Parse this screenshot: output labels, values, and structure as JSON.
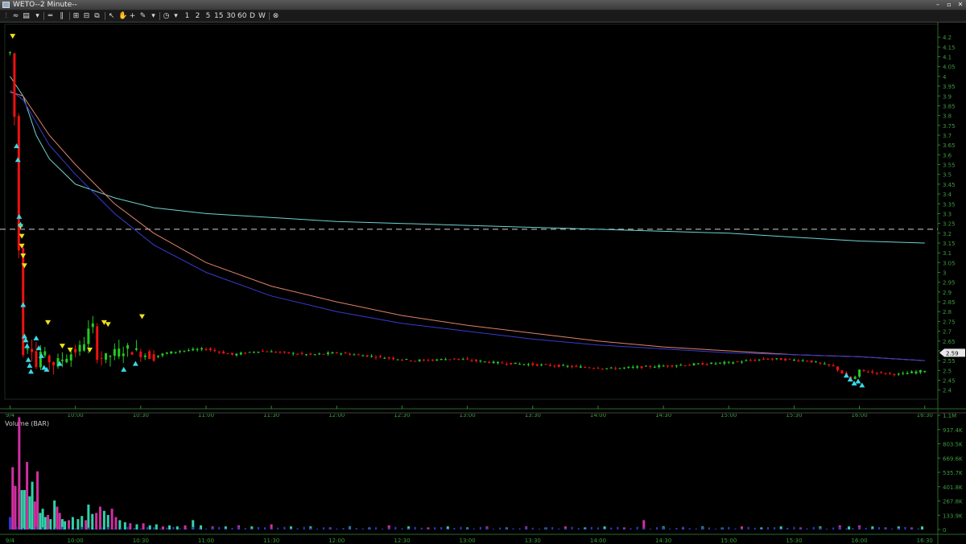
{
  "window": {
    "title": "WETO--2 Minute--",
    "minimize": "–",
    "maximize": "▫",
    "close": "✕"
  },
  "toolbar": {
    "intervals": [
      "1",
      "2",
      "5",
      "15",
      "30",
      "60",
      "D",
      "W"
    ]
  },
  "chart_data": {
    "type": "candlestick",
    "symbol": "WETO",
    "interval": "2 Minute",
    "price_axis": {
      "ticks": [
        4.2,
        4.15,
        4.1,
        4.05,
        4,
        3.95,
        3.9,
        3.85,
        3.8,
        3.75,
        3.7,
        3.65,
        3.6,
        3.55,
        3.5,
        3.45,
        3.4,
        3.35,
        3.3,
        3.25,
        3.2,
        3.15,
        3.1,
        3.05,
        3,
        2.95,
        2.9,
        2.85,
        2.8,
        2.75,
        2.7,
        2.65,
        2.6,
        2.55,
        2.5,
        2.45,
        2.4
      ],
      "range": [
        2.37,
        4.25
      ],
      "last_price": "2.59"
    },
    "time_axis": {
      "labels": [
        "9/4",
        "10:00",
        "10:30",
        "11:00",
        "11:30",
        "12:00",
        "12:30",
        "13:00",
        "13:30",
        "14:00",
        "14:30",
        "15:00",
        "15:30",
        "16:00",
        "16:30"
      ]
    },
    "reference_line": 3.22,
    "grid": false,
    "price_series": [
      [
        9.5,
        4.12
      ],
      [
        9.52,
        4.18
      ],
      [
        9.54,
        3.6
      ],
      [
        9.56,
        3.2
      ],
      [
        9.58,
        2.95
      ],
      [
        9.6,
        2.6
      ],
      [
        9.62,
        2.52
      ],
      [
        9.64,
        2.68
      ],
      [
        9.66,
        2.55
      ],
      [
        9.68,
        2.75
      ],
      [
        9.7,
        2.52
      ],
      [
        9.72,
        2.62
      ],
      [
        9.74,
        2.58
      ],
      [
        9.76,
        2.56
      ],
      [
        9.78,
        2.6
      ],
      [
        9.8,
        2.55
      ],
      [
        9.84,
        2.53
      ],
      [
        9.9,
        2.56
      ],
      [
        9.95,
        2.58
      ],
      [
        10.0,
        2.6
      ],
      [
        10.05,
        2.62
      ],
      [
        10.1,
        2.7
      ],
      [
        10.13,
        2.74
      ],
      [
        10.16,
        2.58
      ],
      [
        10.22,
        2.56
      ],
      [
        10.3,
        2.59
      ],
      [
        10.4,
        2.61
      ],
      [
        10.5,
        2.59
      ],
      [
        10.6,
        2.57
      ],
      [
        10.7,
        2.59
      ],
      [
        10.8,
        2.6
      ],
      [
        11.0,
        2.61
      ],
      [
        11.2,
        2.58
      ],
      [
        11.4,
        2.6
      ],
      [
        11.6,
        2.59
      ],
      [
        11.8,
        2.58
      ],
      [
        12.0,
        2.59
      ],
      [
        12.3,
        2.57
      ],
      [
        12.6,
        2.55
      ],
      [
        12.9,
        2.56
      ],
      [
        13.2,
        2.54
      ],
      [
        13.5,
        2.53
      ],
      [
        13.8,
        2.52
      ],
      [
        14.1,
        2.51
      ],
      [
        14.4,
        2.52
      ],
      [
        14.7,
        2.53
      ],
      [
        15.0,
        2.54
      ],
      [
        15.3,
        2.56
      ],
      [
        15.6,
        2.55
      ],
      [
        15.8,
        2.52
      ],
      [
        15.9,
        2.47
      ],
      [
        15.95,
        2.45
      ],
      [
        16.0,
        2.5
      ],
      [
        16.1,
        2.49
      ],
      [
        16.3,
        2.48
      ],
      [
        16.5,
        2.5
      ]
    ],
    "moving_averages": [
      {
        "color": "#6fd3d3",
        "points": [
          [
            9.5,
            4.0
          ],
          [
            9.6,
            3.9
          ],
          [
            9.7,
            3.7
          ],
          [
            9.8,
            3.58
          ],
          [
            10.0,
            3.45
          ],
          [
            10.3,
            3.38
          ],
          [
            10.6,
            3.33
          ],
          [
            11.0,
            3.3
          ],
          [
            12.0,
            3.26
          ],
          [
            13.0,
            3.24
          ],
          [
            14.0,
            3.22
          ],
          [
            15.0,
            3.2
          ],
          [
            15.5,
            3.18
          ],
          [
            16.0,
            3.16
          ],
          [
            16.5,
            3.15
          ]
        ]
      },
      {
        "color": "#e0826a",
        "points": [
          [
            9.5,
            3.92
          ],
          [
            9.6,
            3.9
          ],
          [
            9.8,
            3.7
          ],
          [
            10.0,
            3.55
          ],
          [
            10.3,
            3.35
          ],
          [
            10.6,
            3.2
          ],
          [
            11.0,
            3.05
          ],
          [
            11.5,
            2.93
          ],
          [
            12.0,
            2.85
          ],
          [
            12.5,
            2.78
          ],
          [
            13.0,
            2.73
          ],
          [
            13.5,
            2.69
          ],
          [
            14.0,
            2.65
          ],
          [
            14.5,
            2.62
          ],
          [
            15.0,
            2.6
          ],
          [
            15.5,
            2.58
          ],
          [
            16.0,
            2.57
          ],
          [
            16.5,
            2.55
          ]
        ]
      },
      {
        "color": "#3a3acf",
        "points": [
          [
            9.5,
            3.93
          ],
          [
            9.6,
            3.88
          ],
          [
            9.8,
            3.65
          ],
          [
            10.0,
            3.5
          ],
          [
            10.3,
            3.3
          ],
          [
            10.6,
            3.14
          ],
          [
            11.0,
            3.0
          ],
          [
            11.5,
            2.88
          ],
          [
            12.0,
            2.8
          ],
          [
            12.5,
            2.74
          ],
          [
            13.0,
            2.7
          ],
          [
            13.5,
            2.66
          ],
          [
            14.0,
            2.63
          ],
          [
            14.5,
            2.61
          ],
          [
            15.0,
            2.59
          ],
          [
            15.5,
            2.58
          ],
          [
            16.0,
            2.57
          ],
          [
            16.5,
            2.55
          ]
        ]
      }
    ],
    "signals": {
      "sell": [
        [
          9.52,
          4.2
        ],
        [
          9.58,
          3.23
        ],
        [
          9.59,
          3.18
        ],
        [
          9.59,
          3.13
        ],
        [
          9.6,
          3.08
        ],
        [
          9.61,
          3.03
        ],
        [
          9.79,
          2.74
        ],
        [
          9.9,
          2.62
        ],
        [
          9.96,
          2.6
        ],
        [
          10.11,
          2.6
        ],
        [
          10.22,
          2.74
        ],
        [
          10.25,
          2.73
        ],
        [
          10.51,
          2.77
        ]
      ],
      "buy": [
        [
          9.55,
          3.65
        ],
        [
          9.56,
          3.58
        ],
        [
          9.57,
          3.29
        ],
        [
          9.58,
          3.25
        ],
        [
          9.6,
          2.84
        ],
        [
          9.61,
          2.68
        ],
        [
          9.62,
          2.66
        ],
        [
          9.63,
          2.63
        ],
        [
          9.64,
          2.56
        ],
        [
          9.65,
          2.53
        ],
        [
          9.66,
          2.5
        ],
        [
          9.7,
          2.67
        ],
        [
          9.72,
          2.62
        ],
        [
          9.74,
          2.58
        ],
        [
          9.76,
          2.52
        ],
        [
          9.78,
          2.51
        ],
        [
          9.88,
          2.54
        ],
        [
          10.37,
          2.51
        ],
        [
          10.46,
          2.54
        ],
        [
          15.9,
          2.48
        ],
        [
          15.93,
          2.46
        ],
        [
          15.96,
          2.44
        ],
        [
          15.99,
          2.45
        ],
        [
          16.02,
          2.43
        ]
      ]
    },
    "volume": {
      "title": "Volume (BAR)",
      "ticks": [
        "1.1M",
        "937.4K",
        "803.5K",
        "669.6K",
        "535.7K",
        "401.8K",
        "267.8K",
        "133.9K",
        "0"
      ],
      "max": 1100000,
      "up_color": "#2fd3a8",
      "down_color": "#d02fa0",
      "neutral_color": "#2a3ad0",
      "bars": [
        [
          9.5,
          120000,
          "n"
        ],
        [
          9.52,
          600000,
          "d"
        ],
        [
          9.54,
          420000,
          "d"
        ],
        [
          9.57,
          1080000,
          "d"
        ],
        [
          9.59,
          380000,
          "u"
        ],
        [
          9.61,
          380000,
          "u"
        ],
        [
          9.63,
          650000,
          "d"
        ],
        [
          9.65,
          320000,
          "u"
        ],
        [
          9.67,
          460000,
          "u"
        ],
        [
          9.69,
          270000,
          "d"
        ],
        [
          9.71,
          560000,
          "d"
        ],
        [
          9.73,
          160000,
          "u"
        ],
        [
          9.75,
          200000,
          "u"
        ],
        [
          9.77,
          120000,
          "u"
        ],
        [
          9.79,
          140000,
          "d"
        ],
        [
          9.81,
          100000,
          "u"
        ],
        [
          9.84,
          280000,
          "u"
        ],
        [
          9.86,
          220000,
          "d"
        ],
        [
          9.88,
          160000,
          "d"
        ],
        [
          9.9,
          100000,
          "u"
        ],
        [
          9.92,
          80000,
          "u"
        ],
        [
          9.95,
          90000,
          "d"
        ],
        [
          9.98,
          120000,
          "u"
        ],
        [
          10.02,
          100000,
          "u"
        ],
        [
          10.05,
          130000,
          "u"
        ],
        [
          10.08,
          90000,
          "d"
        ],
        [
          10.1,
          240000,
          "u"
        ],
        [
          10.13,
          150000,
          "u"
        ],
        [
          10.16,
          160000,
          "d"
        ],
        [
          10.19,
          220000,
          "d"
        ],
        [
          10.22,
          180000,
          "u"
        ],
        [
          10.25,
          140000,
          "u"
        ],
        [
          10.28,
          200000,
          "d"
        ],
        [
          10.31,
          120000,
          "d"
        ],
        [
          10.34,
          90000,
          "u"
        ],
        [
          10.38,
          70000,
          "u"
        ],
        [
          10.42,
          60000,
          "d"
        ],
        [
          10.47,
          50000,
          "u"
        ],
        [
          10.52,
          60000,
          "d"
        ],
        [
          10.57,
          40000,
          "u"
        ],
        [
          10.62,
          50000,
          "u"
        ],
        [
          10.67,
          30000,
          "d"
        ],
        [
          10.72,
          40000,
          "u"
        ],
        [
          10.78,
          30000,
          "u"
        ],
        [
          10.84,
          40000,
          "d"
        ],
        [
          10.9,
          90000,
          "u"
        ],
        [
          10.96,
          40000,
          "u"
        ],
        [
          11.05,
          30000,
          "d"
        ],
        [
          11.15,
          30000,
          "u"
        ],
        [
          11.25,
          40000,
          "d"
        ],
        [
          11.35,
          30000,
          "u"
        ],
        [
          11.5,
          50000,
          "d"
        ],
        [
          11.65,
          30000,
          "u"
        ],
        [
          11.8,
          30000,
          "u"
        ],
        [
          11.95,
          20000,
          "d"
        ],
        [
          12.1,
          30000,
          "u"
        ],
        [
          12.25,
          20000,
          "u"
        ],
        [
          12.4,
          40000,
          "d"
        ],
        [
          12.55,
          30000,
          "u"
        ],
        [
          12.7,
          20000,
          "d"
        ],
        [
          12.85,
          30000,
          "u"
        ],
        [
          13.0,
          20000,
          "u"
        ],
        [
          13.15,
          30000,
          "d"
        ],
        [
          13.3,
          20000,
          "u"
        ],
        [
          13.45,
          30000,
          "d"
        ],
        [
          13.6,
          20000,
          "u"
        ],
        [
          13.75,
          30000,
          "d"
        ],
        [
          13.9,
          20000,
          "u"
        ],
        [
          14.05,
          30000,
          "u"
        ],
        [
          14.2,
          20000,
          "d"
        ],
        [
          14.35,
          90000,
          "d"
        ],
        [
          14.5,
          30000,
          "u"
        ],
        [
          14.65,
          20000,
          "d"
        ],
        [
          14.8,
          30000,
          "u"
        ],
        [
          14.95,
          20000,
          "u"
        ],
        [
          15.1,
          30000,
          "d"
        ],
        [
          15.25,
          20000,
          "u"
        ],
        [
          15.4,
          30000,
          "u"
        ],
        [
          15.55,
          20000,
          "d"
        ],
        [
          15.7,
          30000,
          "u"
        ],
        [
          15.85,
          40000,
          "d"
        ],
        [
          15.92,
          30000,
          "u"
        ],
        [
          16.0,
          40000,
          "d"
        ],
        [
          16.1,
          30000,
          "u"
        ],
        [
          16.2,
          20000,
          "d"
        ],
        [
          16.3,
          30000,
          "u"
        ],
        [
          16.4,
          20000,
          "d"
        ],
        [
          16.48,
          30000,
          "u"
        ]
      ]
    }
  }
}
